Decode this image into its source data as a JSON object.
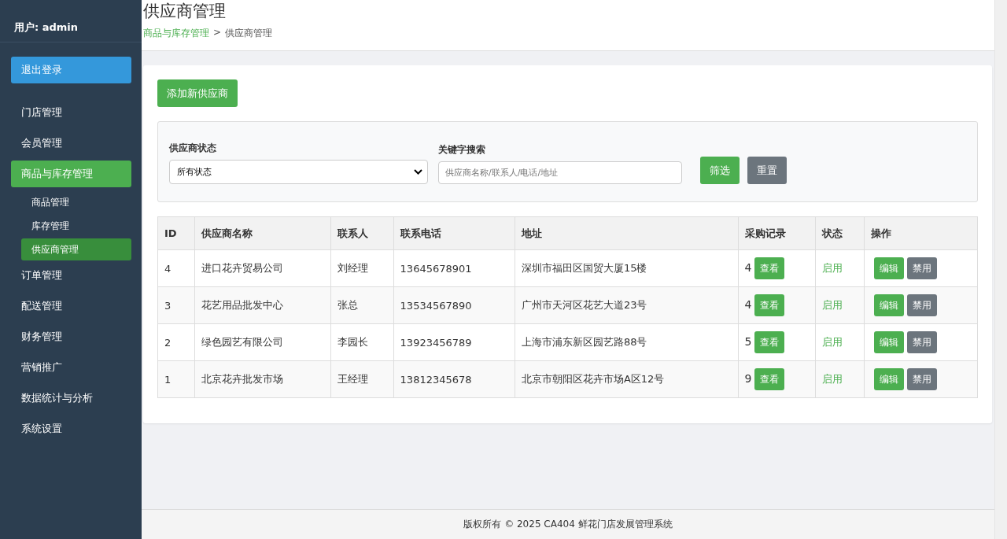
{
  "sidebar": {
    "user": "用户: admin",
    "logout": "退出登录",
    "items": [
      {
        "label": "门店管理",
        "selected": false
      },
      {
        "label": "会员管理",
        "selected": false
      },
      {
        "label": "商品与库存管理",
        "selected": true,
        "children": [
          {
            "label": "商品管理",
            "selected": false
          },
          {
            "label": "库存管理",
            "selected": false
          },
          {
            "label": "供应商管理",
            "selected": true
          }
        ]
      },
      {
        "label": "订单管理",
        "selected": false
      },
      {
        "label": "配送管理",
        "selected": false
      },
      {
        "label": "财务管理",
        "selected": false
      },
      {
        "label": "营销推广",
        "selected": false
      },
      {
        "label": "数据统计与分析",
        "selected": false
      },
      {
        "label": "系统设置",
        "selected": false
      }
    ]
  },
  "header": {
    "title": "供应商管理",
    "breadcrumb": {
      "parent": "商品与库存管理",
      "separator": ">",
      "current": "供应商管理"
    }
  },
  "add_button": "添加新供应商",
  "filter": {
    "status_label": "供应商状态",
    "status_value": "所有状态",
    "keyword_label": "关键字搜索",
    "keyword_placeholder": "供应商名称/联系人/电话/地址",
    "filter_button": "筛选",
    "reset_button": "重置"
  },
  "table": {
    "columns": [
      "ID",
      "供应商名称",
      "联系人",
      "联系电话",
      "地址",
      "采购记录",
      "状态",
      "操作"
    ],
    "rows": [
      {
        "id": "4",
        "name": "进口花卉贸易公司",
        "contact": "刘经理",
        "phone": "13645678901",
        "address": "深圳市福田区国贸大厦15楼",
        "purchases": "4",
        "view": "查看",
        "status": "启用",
        "enabled": true,
        "edit": "编辑",
        "disable": "禁用"
      },
      {
        "id": "3",
        "name": "花艺用品批发中心",
        "contact": "张总",
        "phone": "13534567890",
        "address": "广州市天河区花艺大道23号",
        "purchases": "4",
        "view": "查看",
        "status": "启用",
        "enabled": true,
        "edit": "编辑",
        "disable": "禁用"
      },
      {
        "id": "2",
        "name": "绿色园艺有限公司",
        "contact": "李园长",
        "phone": "13923456789",
        "address": "上海市浦东新区园艺路88号",
        "purchases": "5",
        "view": "查看",
        "status": "启用",
        "enabled": true,
        "edit": "编辑",
        "disable": "禁用"
      },
      {
        "id": "1",
        "name": "北京花卉批发市场",
        "contact": "王经理",
        "phone": "13812345678",
        "address": "北京市朝阳区花卉市场A区12号",
        "purchases": "9",
        "view": "查看",
        "status": "启用",
        "enabled": true,
        "edit": "编辑",
        "disable": "禁用"
      }
    ]
  },
  "footer": "版权所有 © 2025 CA404 鲜花门店发展管理系统"
}
